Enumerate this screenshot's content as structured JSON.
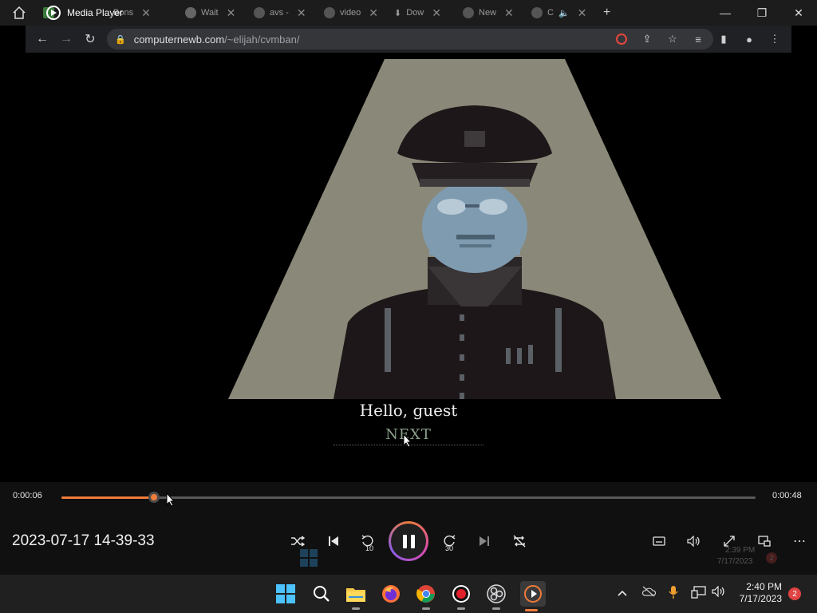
{
  "titlebar": {
    "app_title": "Media Player",
    "tabs": [
      {
        "label": "Fa"
      },
      {
        "label": "Bons"
      },
      {
        "label": "Wait"
      },
      {
        "label": "avs -"
      },
      {
        "label": "video"
      },
      {
        "label": "Dow"
      },
      {
        "label": "New"
      },
      {
        "label": "C"
      }
    ],
    "new_tab": "+"
  },
  "address_bar": {
    "url_host": "computernewb.com",
    "url_path": "/~elijah/cvmban/"
  },
  "video": {
    "subtitle": "Hello, guest",
    "next_label": "NEXT",
    "colors": {
      "beam": "#8a8878",
      "skin": "#7f9bb0",
      "uniform": "#1a1416"
    }
  },
  "seek": {
    "current_time": "0:00:06",
    "total_time": "0:00:48",
    "progress": 0.133,
    "accent": "#ef7b3a"
  },
  "controls": {
    "media_title": "2023-07-17 14-39-33",
    "skip_back_label": "10",
    "skip_fwd_label": "30"
  },
  "ghost_tray": {
    "time": "2:39 PM",
    "date": "7/17/2023",
    "badge": "2"
  },
  "taskbar": {
    "time": "2:40 PM",
    "date": "7/17/2023",
    "notifications": "2"
  }
}
